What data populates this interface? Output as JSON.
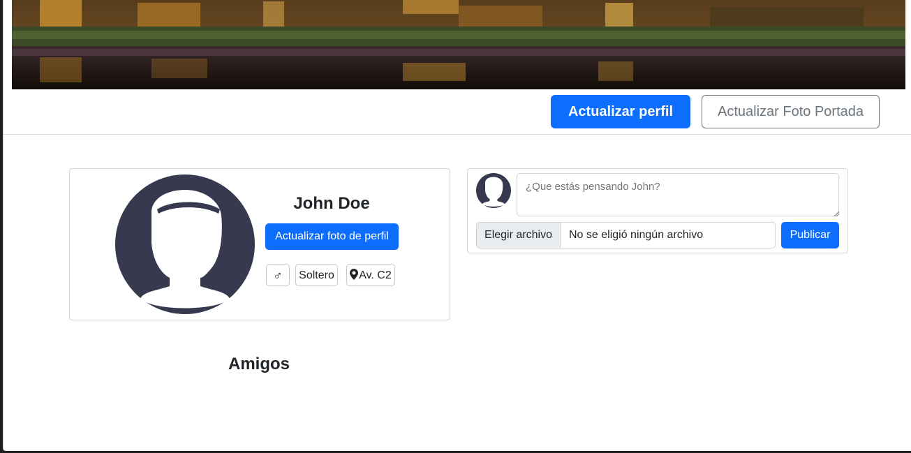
{
  "header": {
    "update_profile_label": "Actualizar perfil",
    "update_cover_label": "Actualizar Foto Portada"
  },
  "profile": {
    "name": "John Doe",
    "update_photo_label": "Actualizar foto de perfil",
    "gender_symbol": "♂",
    "status": "Soltero",
    "location": "Av. C2"
  },
  "composer": {
    "placeholder": "¿Que estás pensando John?",
    "file_button_label": "Elegir archivo",
    "file_status": "No se eligió ningún archivo",
    "publish_label": "Publicar"
  },
  "friends": {
    "title": "Amigos"
  },
  "colors": {
    "primary": "#0d6efd",
    "avatar": "#373a4f",
    "outline": "#6c757d"
  },
  "icons": {
    "gender": "male-icon",
    "location": "map-pin-icon",
    "avatar": "user-silhouette-icon"
  }
}
